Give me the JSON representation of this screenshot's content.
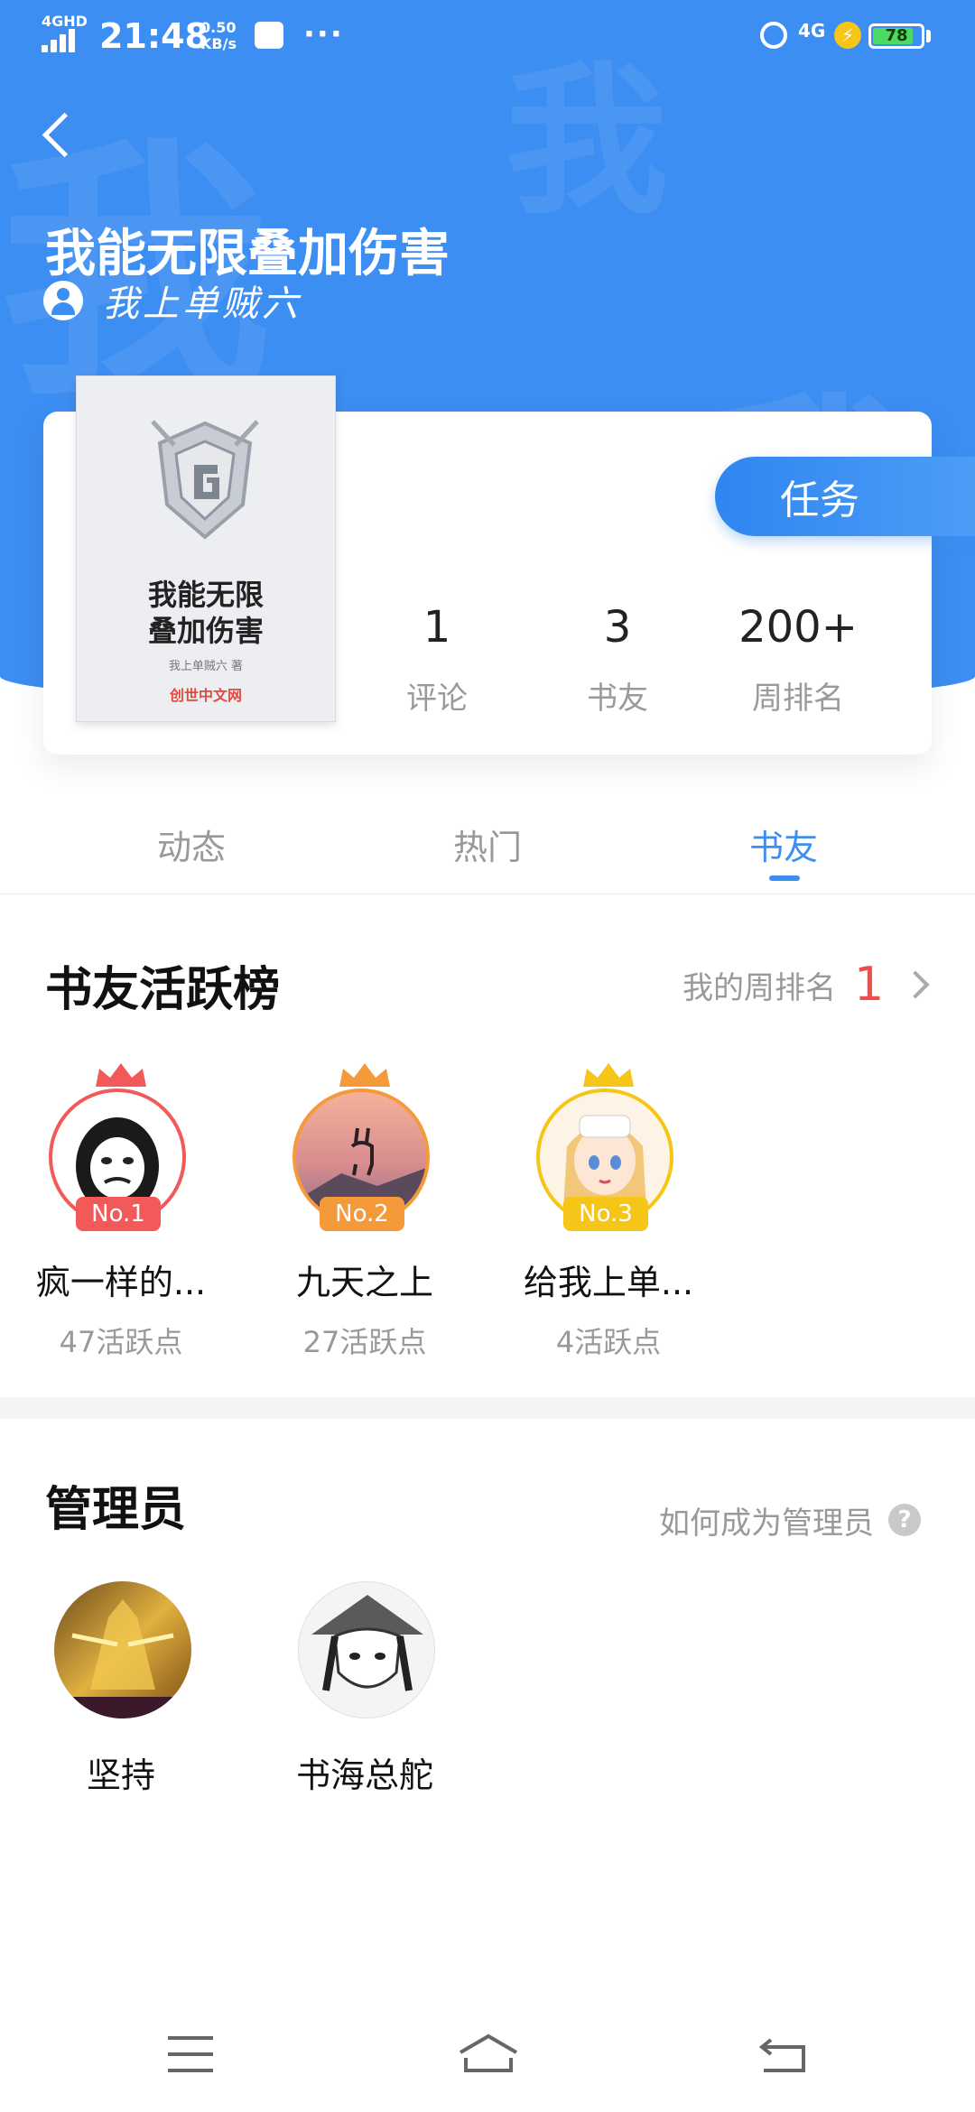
{
  "status_bar": {
    "network": "4GHD",
    "time": "21:48",
    "speed_value": "0.50",
    "speed_unit": "KB/s",
    "more": "···",
    "mobile_data": "4G",
    "battery": "78"
  },
  "header": {
    "book_title": "我能无限叠加伤害",
    "author": "我上单贼六",
    "background_watermark": "我"
  },
  "cover": {
    "title_line1": "我能无限",
    "title_line2": "叠加伤害",
    "author": "我上单贼六 著",
    "publisher": "创世中文网"
  },
  "task_button": "任务",
  "stats": [
    {
      "value": "1",
      "label": "评论"
    },
    {
      "value": "3",
      "label": "书友"
    },
    {
      "value": "200+",
      "label": "周排名"
    }
  ],
  "tabs": [
    {
      "label": "动态",
      "active": false
    },
    {
      "label": "热门",
      "active": false
    },
    {
      "label": "书友",
      "active": true
    }
  ],
  "leaderboard": {
    "title": "书友活跃榜",
    "my_rank_label": "我的周排名",
    "my_rank": "1",
    "rankers": [
      {
        "name": "疯一样的...",
        "points": "47活跃点",
        "badge": "No.1",
        "color": "#f25a5a"
      },
      {
        "name": "九天之上",
        "points": "27活跃点",
        "badge": "No.2",
        "color": "#f59a3a"
      },
      {
        "name": "给我上单...",
        "points": "4活跃点",
        "badge": "No.3",
        "color": "#f5c518"
      }
    ]
  },
  "admins": {
    "title": "管理员",
    "how_to_label": "如何成为管理员",
    "help_icon": "?",
    "list": [
      {
        "name": "坚持"
      },
      {
        "name": "书海总舵"
      }
    ]
  },
  "colors": {
    "accent": "#3d8ef2",
    "rank_red": "#f24d4d"
  }
}
